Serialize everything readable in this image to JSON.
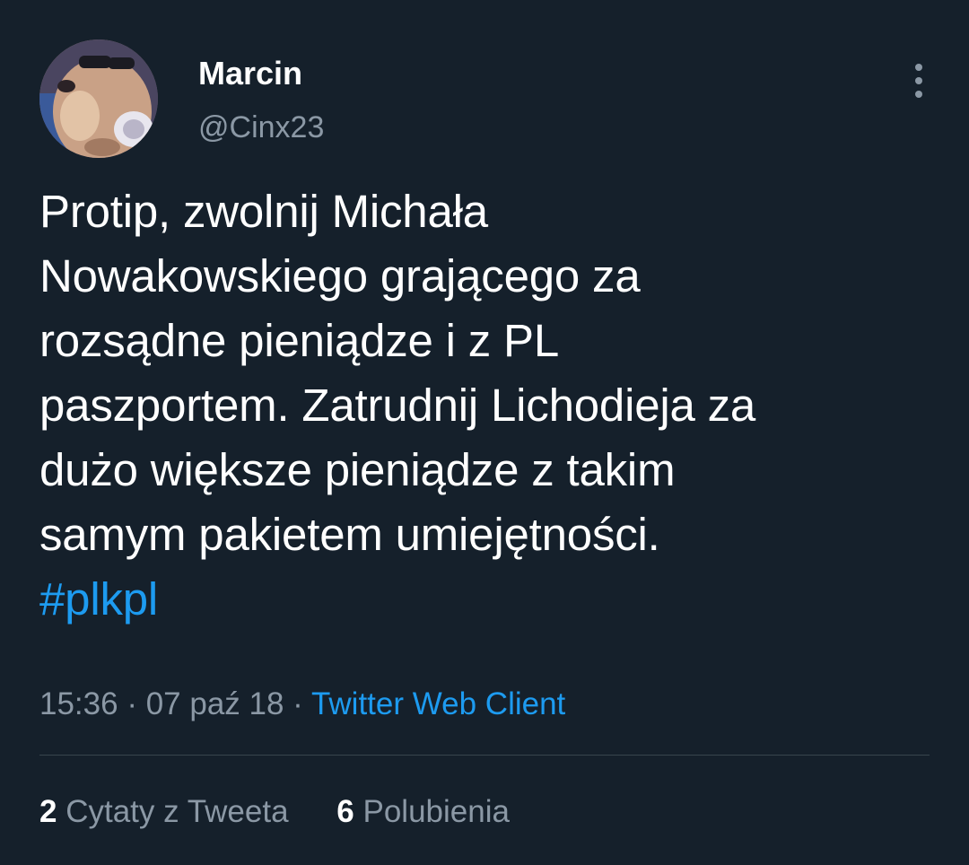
{
  "author": {
    "display_name": "Marcin",
    "handle": "@Cinx23",
    "avatar_icon": "dog-with-sunglasses-avatar"
  },
  "more_icon": "more-vertical-icon",
  "tweet": {
    "lines": [
      "Protip, zwolnij Michała",
      "Nowakowskiego grającego za",
      "rozsądne pieniądze i z PL",
      "paszportem. Zatrudnij Lichodieja za",
      "dużo większe pieniądze z takim",
      "samym pakietem umiejętności."
    ],
    "hashtag": "#plkpl"
  },
  "meta": {
    "time": "15:36",
    "separator": " · ",
    "date": "07 paź 18",
    "source": "Twitter Web Client"
  },
  "stats": {
    "quotes_count": "2",
    "quotes_label": "Cytaty z Tweeta",
    "likes_count": "6",
    "likes_label": "Polubienia"
  },
  "colors": {
    "background": "#15202b",
    "text_primary": "#ffffff",
    "text_secondary": "#8b98a5",
    "accent": "#1d9bf0",
    "divider": "#38444d"
  }
}
